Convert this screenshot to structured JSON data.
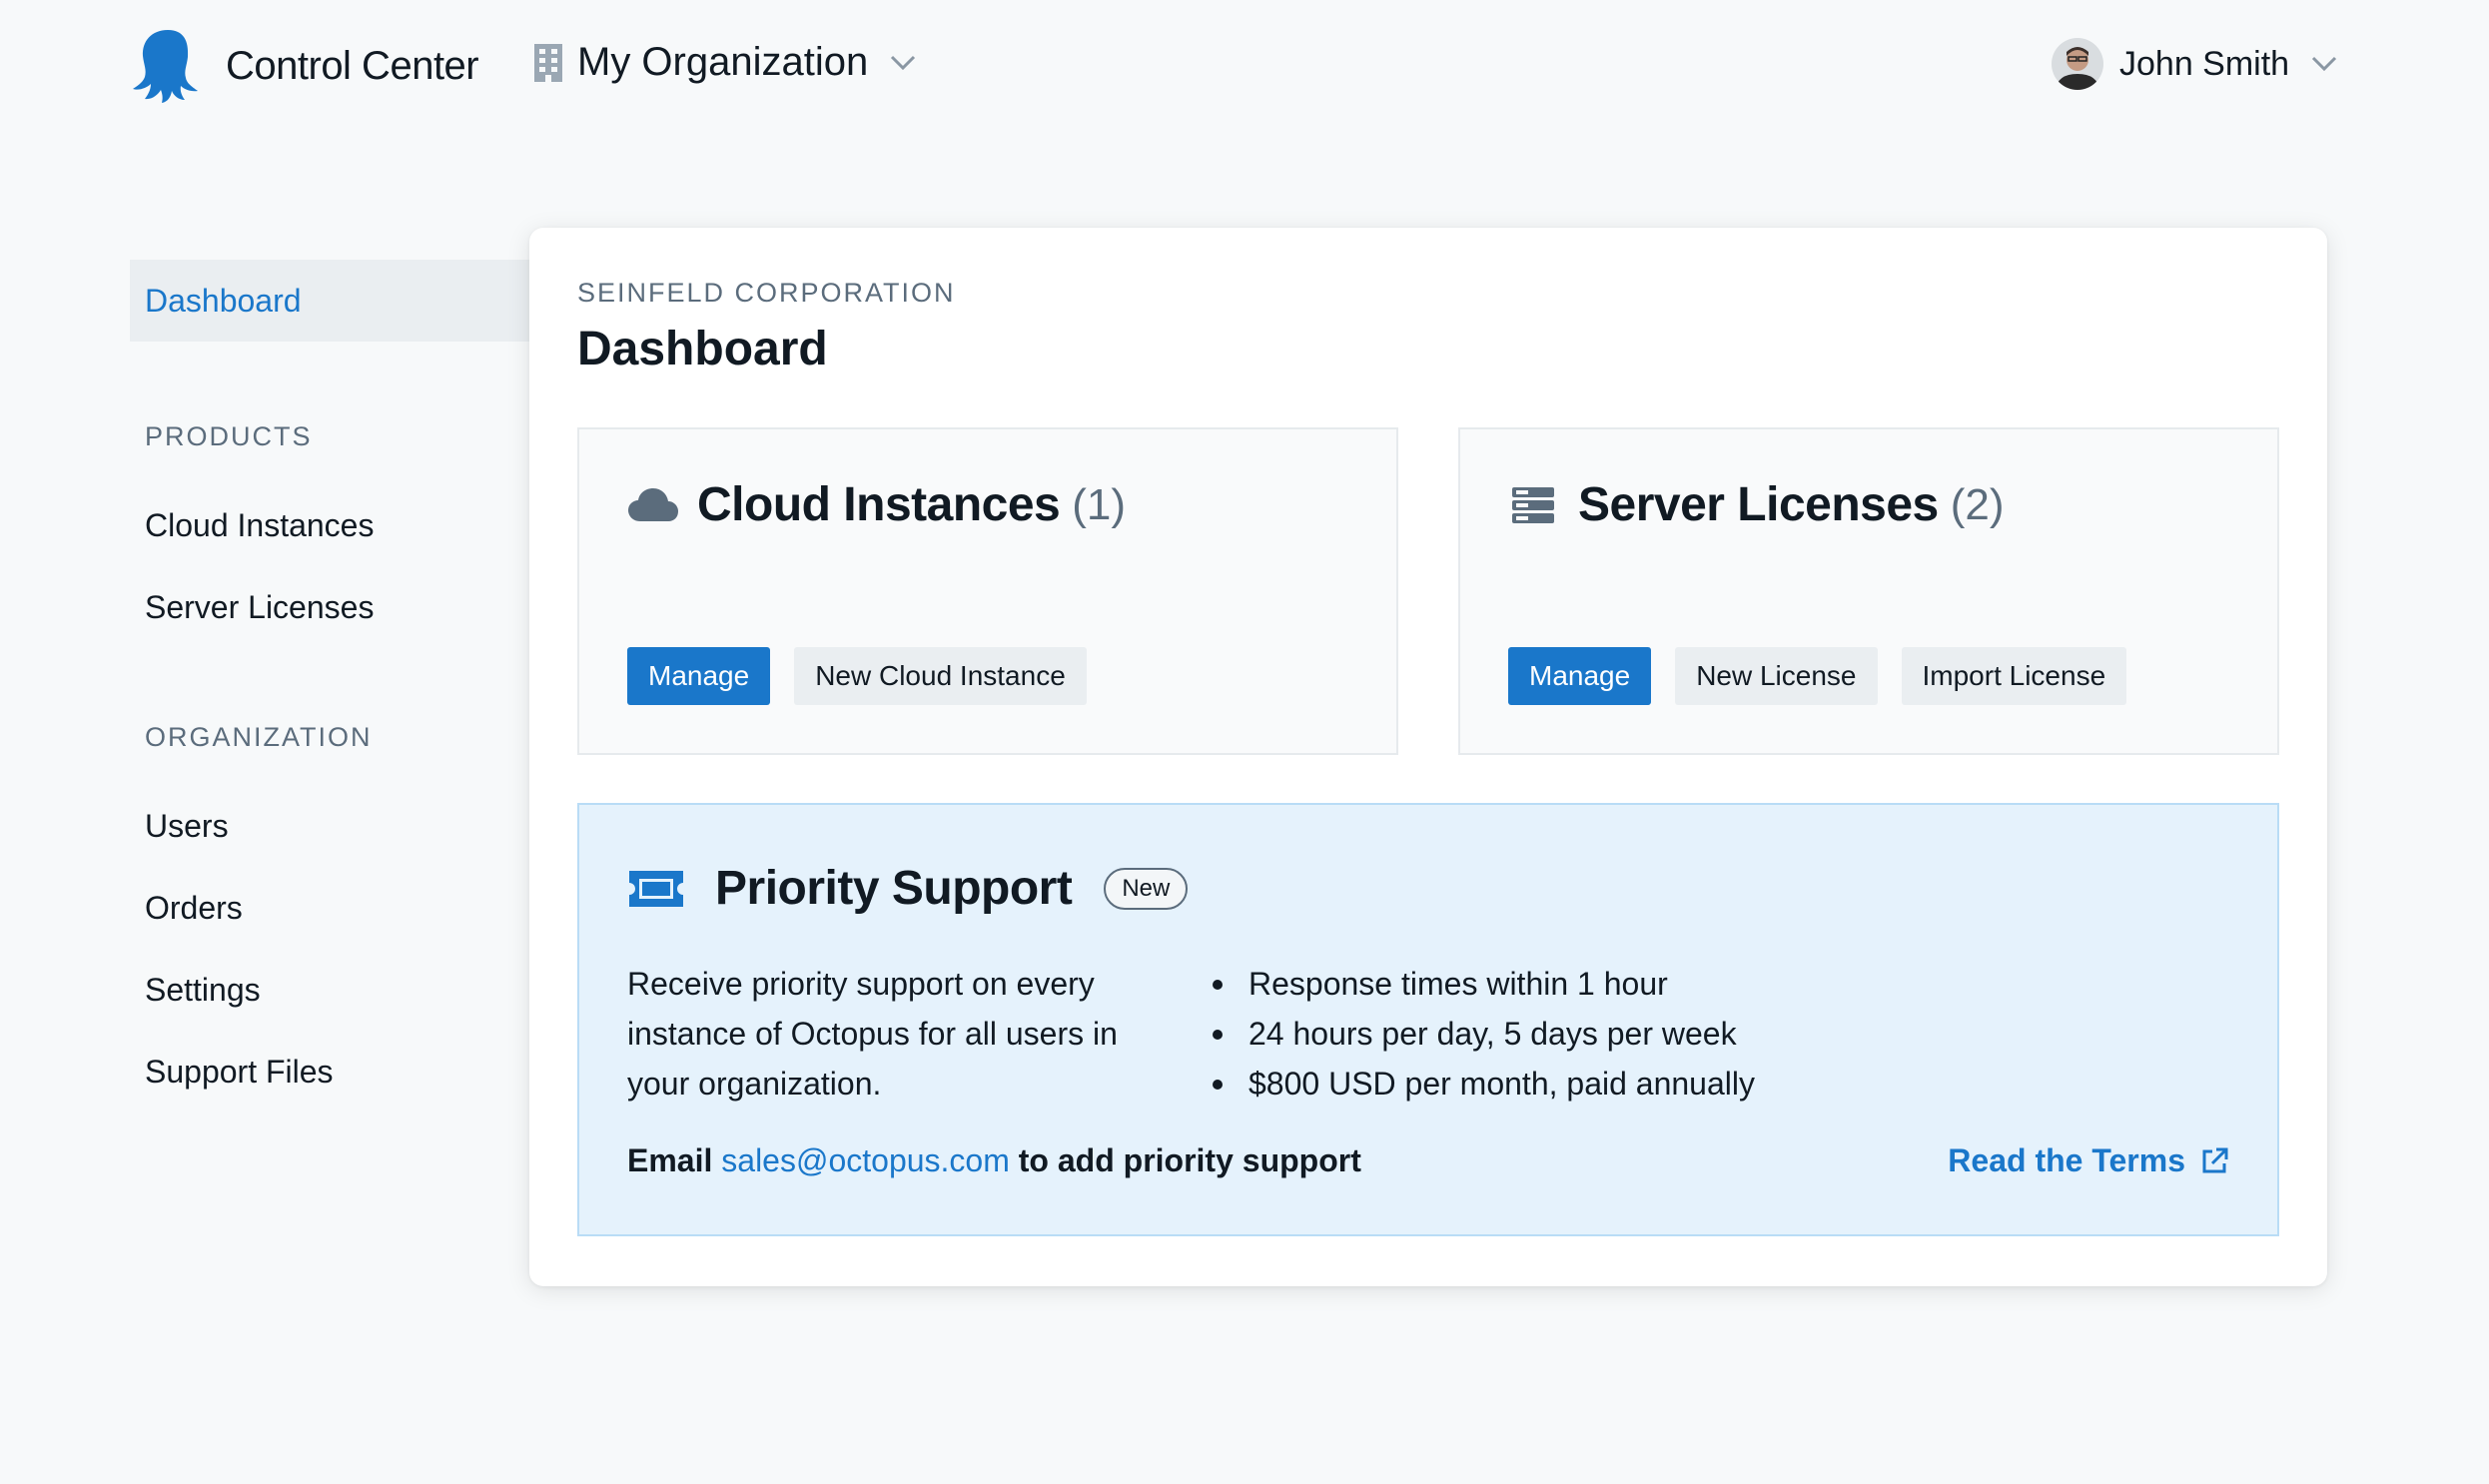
{
  "header": {
    "brand_name": "Control Center",
    "org_name": "My Organization",
    "user_name": "John Smith"
  },
  "sidebar": {
    "active_item": "Dashboard",
    "products_heading": "PRODUCTS",
    "products": [
      {
        "label": "Cloud Instances"
      },
      {
        "label": "Server Licenses"
      }
    ],
    "organization_heading": "ORGANIZATION",
    "organization": [
      {
        "label": "Users"
      },
      {
        "label": "Orders"
      },
      {
        "label": "Settings"
      },
      {
        "label": "Support Files"
      }
    ]
  },
  "main": {
    "eyebrow": "SEINFELD CORPORATION",
    "title": "Dashboard",
    "cloud_panel": {
      "icon": "cloud-icon",
      "title": "Cloud Instances",
      "count": "(1)",
      "buttons": {
        "manage": "Manage",
        "new": "New Cloud Instance"
      }
    },
    "server_panel": {
      "icon": "server-icon",
      "title": "Server Licenses",
      "count": "(2)",
      "buttons": {
        "manage": "Manage",
        "new": "New License",
        "import": "Import License"
      }
    },
    "support": {
      "icon": "ticket-icon",
      "title": "Priority Support",
      "badge": "New",
      "description": "Receive priority support on every instance of Octopus for all users in your organization.",
      "features": [
        "Response times within 1 hour",
        "24 hours per day, 5 days per week",
        "$800 USD per month, paid annually"
      ],
      "email_prefix": "Email",
      "email": "sales@octopus.com",
      "email_suffix": "to add priority support",
      "terms_link": "Read the Terms"
    }
  },
  "colors": {
    "accent": "#1a77ca",
    "background": "#f7f9fa",
    "support_bg": "#e5f2fc",
    "text": "#111a23",
    "muted": "#5b6c7c"
  }
}
